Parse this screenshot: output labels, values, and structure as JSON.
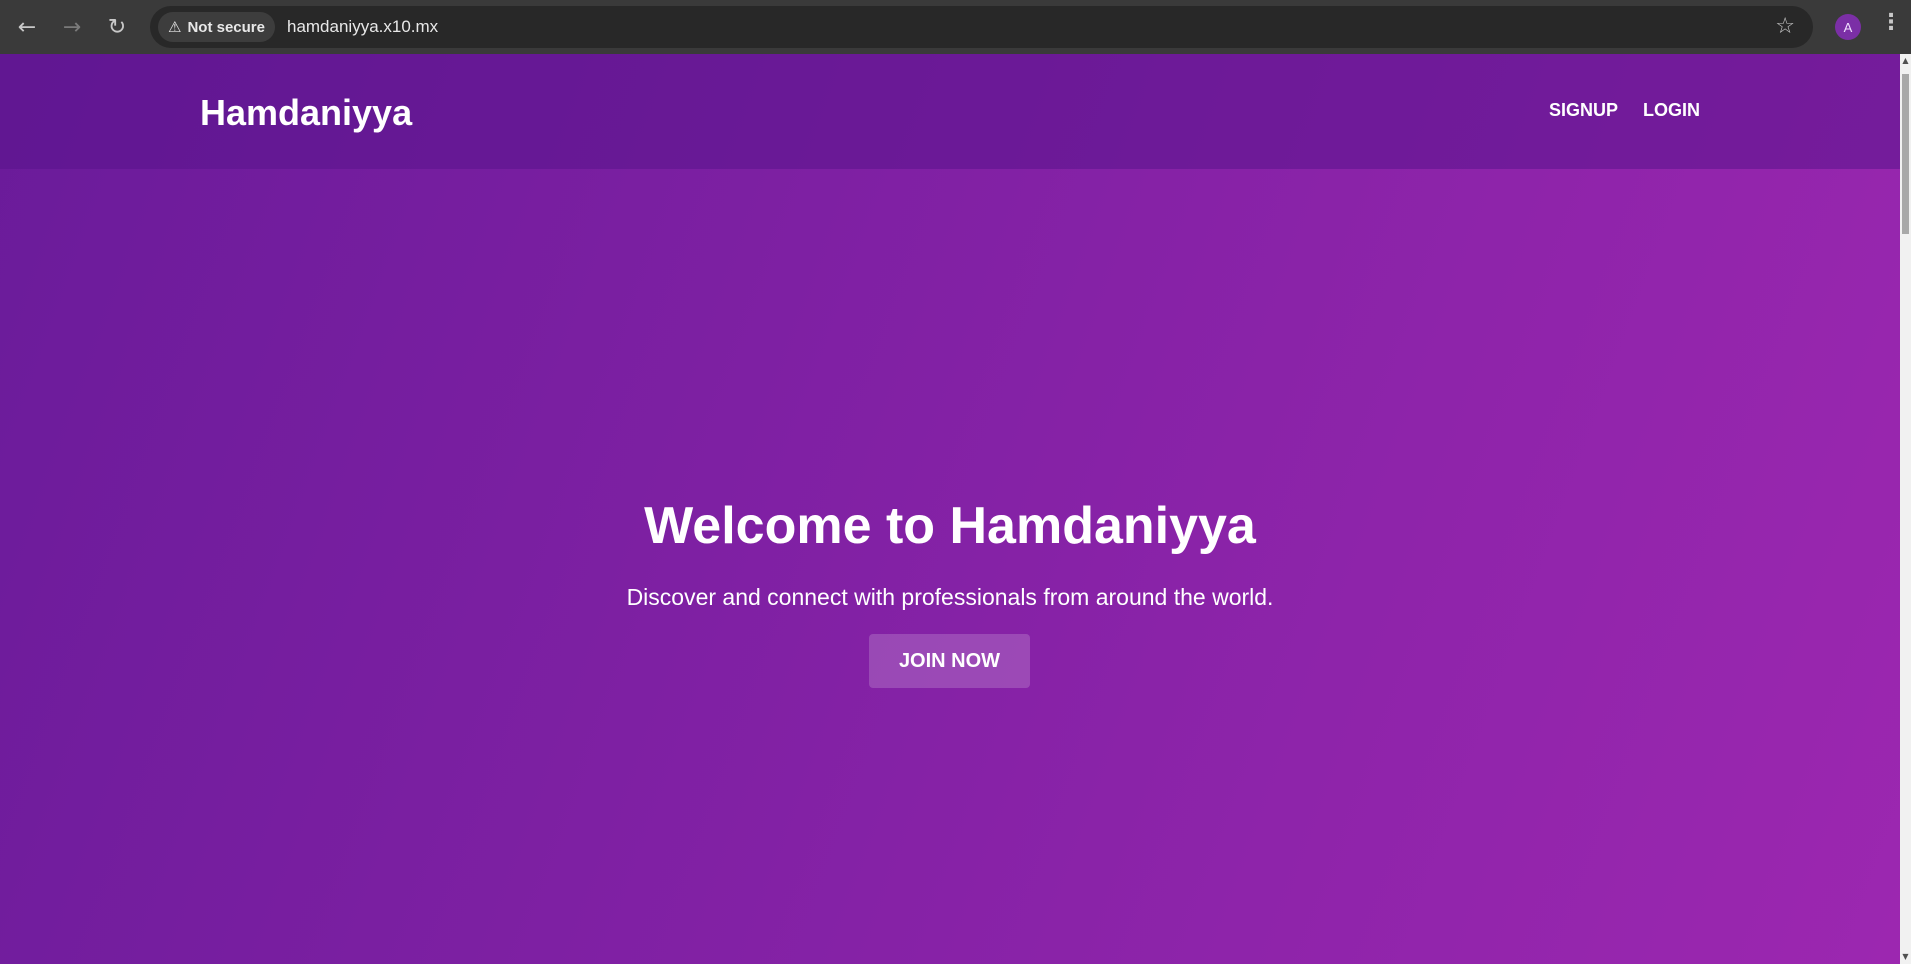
{
  "browser": {
    "back_icon": "arrow-left-icon",
    "forward_icon": "arrow-right-icon",
    "reload_icon": "reload-icon",
    "security_label": "Not secure",
    "url": "hamdaniyya.x10.mx",
    "profile_initial": "A"
  },
  "header": {
    "logo": "Hamdaniyya",
    "nav": {
      "signup": "SIGNUP",
      "login": "LOGIN"
    }
  },
  "hero": {
    "title": "Welcome to Hamdaniyya",
    "subtitle": "Discover and connect with professionals from around the world.",
    "cta": "JOIN NOW"
  },
  "colors": {
    "gradient_start": "#6a1b9a",
    "gradient_end": "#9c27b0",
    "text": "#ffffff"
  }
}
